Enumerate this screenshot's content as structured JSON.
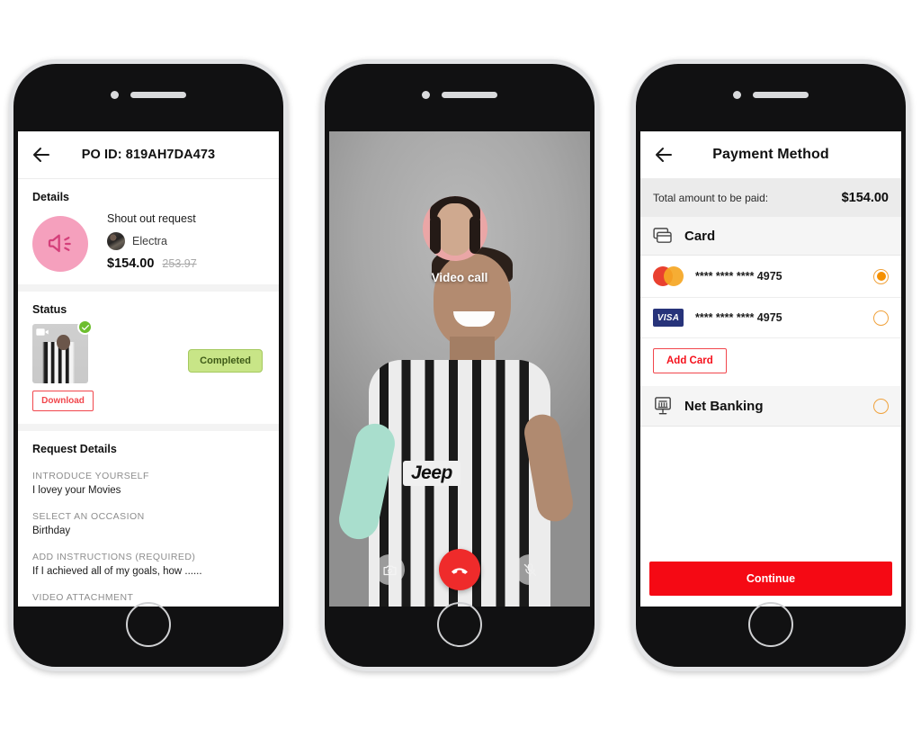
{
  "colors": {
    "accent_red": "#f50914",
    "outline_red": "#f1464c",
    "badge_green_bg": "#c8e587",
    "badge_green_text": "#3e5a17",
    "radio_orange": "#f59000",
    "megaphone_pink": "#f5a0bd",
    "visa_navy": "#27337a",
    "mastercard_red": "#e9402f",
    "mastercard_orange": "#f5a623"
  },
  "order_screen": {
    "back_icon": "back-arrow-icon",
    "title": "PO ID: 819AH7DA473",
    "details": {
      "section_title": "Details",
      "icon": "megaphone-icon",
      "request_type": "Shout out request",
      "artist_name": "Electra",
      "price": "$154.00",
      "old_price": "253.97"
    },
    "status": {
      "section_title": "Status",
      "video_icon": "video-camera-icon",
      "check_icon": "check-circle-icon",
      "download_label": "Download",
      "badge_label": "Completed"
    },
    "request_details": {
      "section_title": "Request Details",
      "fields": [
        {
          "label": "INTRODUCE YOURSELF",
          "value": "I lovey your Movies"
        },
        {
          "label": "SELECT AN OCCASION",
          "value": "Birthday"
        },
        {
          "label": "ADD INSTRUCTIONS (REQUIRED)",
          "value": "If I achieved all of my goals, how ......"
        },
        {
          "label": "VIDEO ATTACHMENT",
          "value": ""
        }
      ]
    }
  },
  "video_call_screen": {
    "label": "Video call",
    "pip": "self-view-avatar",
    "controls": [
      {
        "name": "switch-camera-button",
        "icon": "camera-flip-icon"
      },
      {
        "name": "end-call-button",
        "icon": "phone-hangup-icon"
      },
      {
        "name": "mute-button",
        "icon": "microphone-muted-icon"
      }
    ]
  },
  "payment_screen": {
    "back_icon": "back-arrow-icon",
    "title": "Payment Method",
    "total_label": "Total amount to be paid:",
    "total_value": "$154.00",
    "card_section": {
      "icon": "credit-card-icon",
      "title": "Card",
      "cards": [
        {
          "brand": "mastercard",
          "brand_label": "",
          "number": "**** **** **** 4975",
          "selected": true
        },
        {
          "brand": "visa",
          "brand_label": "VISA",
          "number": "**** **** **** 4975",
          "selected": false
        }
      ],
      "add_card_label": "Add Card"
    },
    "net_banking": {
      "icon": "bank-icon",
      "title": "Net Banking",
      "selected": false
    },
    "continue_label": "Continue"
  }
}
